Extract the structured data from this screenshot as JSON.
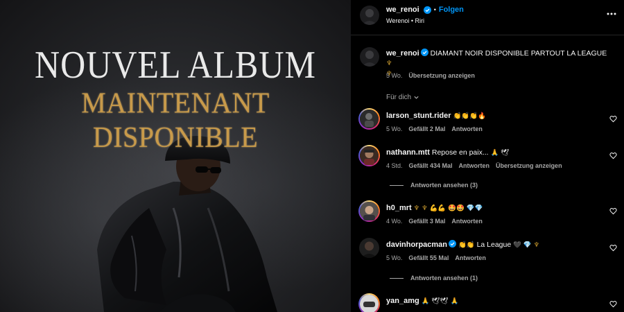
{
  "poster": {
    "title_line1": "NOUVEL ALBUM",
    "title_line2": "MAINTENANT DISPONIBLE"
  },
  "header": {
    "username": "we_renoi",
    "dot": "•",
    "follow_label": "Folgen",
    "subtitle": "Werenoi • Riri"
  },
  "caption": {
    "username": "we_renoi",
    "text": "DIAMANT NOIR DISPONIBLE PARTOUT LA LEAGUE",
    "emoji_end": "♆",
    "emoji_line2": "♆",
    "time": "5 Wo.",
    "translate": "Übersetzung anzeigen"
  },
  "filter": {
    "label": "Für dich"
  },
  "comments": [
    {
      "username": "larson_stunt.rider",
      "text": "",
      "emojis": [
        "👏",
        "👏",
        "👏",
        "🔥"
      ],
      "time": "5 Wo.",
      "likes": "Gefällt 2 Mal",
      "reply": "Antworten",
      "translate": ""
    },
    {
      "username": "nathann.mtt",
      "text": "Repose en paix...",
      "emojis": [
        "🙏",
        "🕊"
      ],
      "time": "4 Std.",
      "likes": "Gefällt 434 Mal",
      "reply": "Antworten",
      "translate": "Übersetzung anzeigen",
      "view_replies": "Antworten ansehen (3)"
    },
    {
      "username": "h0_mrt",
      "text": "",
      "emojis": [
        "♆",
        "♆",
        "💪",
        "💪",
        "🤩",
        "🤩",
        "💎",
        "💎"
      ],
      "time": "4 Wo.",
      "likes": "Gefällt 3 Mal",
      "reply": "Antworten",
      "translate": ""
    },
    {
      "username": "davinhorpacman",
      "text": "La League",
      "emojis_pre": [
        "👏",
        "👏"
      ],
      "emojis": [
        "🖤",
        "💎",
        "♆"
      ],
      "time": "5 Wo.",
      "likes": "Gefällt 55 Mal",
      "reply": "Antworten",
      "translate": "",
      "view_replies": "Antworten ansehen (1)"
    },
    {
      "username": "yan_amg",
      "text": "",
      "emojis": [
        "🙏",
        "🕊",
        "🕊",
        "🙏"
      ],
      "time": "",
      "likes": "",
      "reply": "",
      "translate": ""
    }
  ],
  "colors": {
    "accent_blue": "#0095f6",
    "poster_gold": "#c89a4a",
    "muted_text": "#a8a8a8"
  },
  "icons": {
    "more": "more-horizontal-icon",
    "verified": "verified-badge-icon",
    "heart": "heart-outline-icon",
    "chevron": "chevron-down-icon"
  }
}
